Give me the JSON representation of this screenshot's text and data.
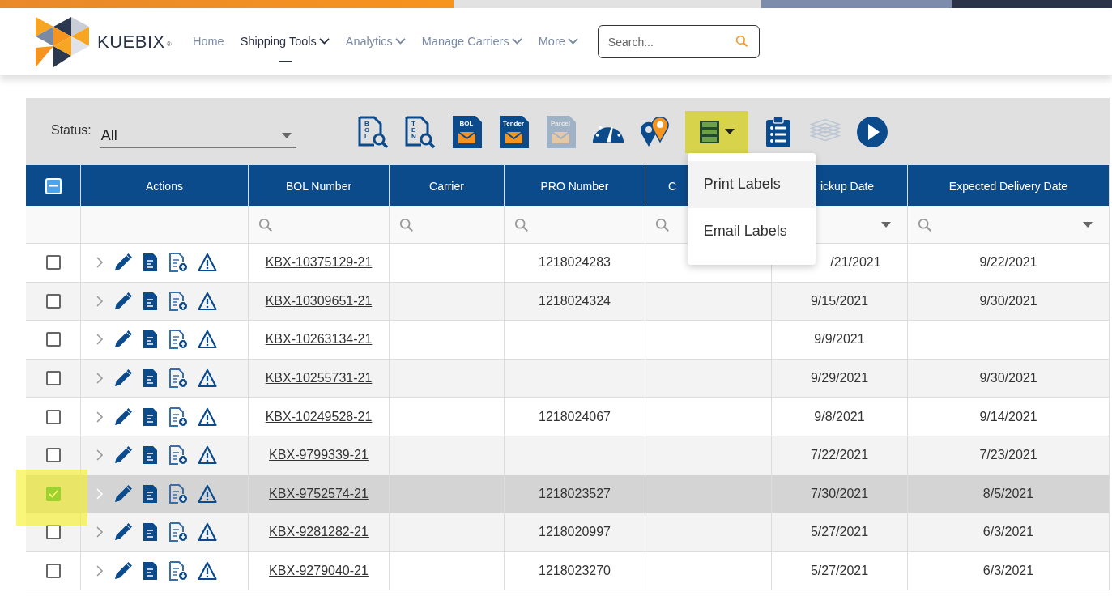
{
  "brand": {
    "name": "KUEBIX",
    "mark": "®"
  },
  "nav": {
    "items": [
      {
        "label": "Home",
        "selected": false,
        "dropdown": false
      },
      {
        "label": "Shipping Tools",
        "selected": true,
        "dropdown": true
      },
      {
        "label": "Analytics",
        "selected": false,
        "dropdown": true
      },
      {
        "label": "Manage Carriers",
        "selected": false,
        "dropdown": true
      },
      {
        "label": "More",
        "selected": false,
        "dropdown": true
      }
    ],
    "search": {
      "placeholder": "Search..."
    }
  },
  "status": {
    "label": "Status:",
    "value": "All"
  },
  "toolbar": [
    {
      "kind": "doc-search",
      "label": "BOL",
      "disabled": false
    },
    {
      "kind": "doc-search",
      "label": "TEN",
      "disabled": false
    },
    {
      "kind": "mail",
      "label": "BOL",
      "disabled": false
    },
    {
      "kind": "mail",
      "label": "Tender",
      "disabled": false
    },
    {
      "kind": "mail",
      "label": "Parcel",
      "disabled": true
    },
    {
      "kind": "gauge",
      "disabled": false
    },
    {
      "kind": "pins",
      "disabled": false
    },
    {
      "kind": "labels",
      "disabled": false,
      "highlighted": true
    },
    {
      "kind": "clipboard",
      "disabled": false
    },
    {
      "kind": "stack",
      "disabled": true
    },
    {
      "kind": "play",
      "disabled": false
    }
  ],
  "labels_menu": {
    "items": [
      {
        "label": "Print Labels",
        "highlighted": true
      },
      {
        "label": "Email Labels",
        "highlighted": false
      }
    ]
  },
  "table": {
    "some_selected": true,
    "columns": [
      {
        "label": "Actions",
        "search_filter": false,
        "dropdown_filter": false
      },
      {
        "label": "BOL Number",
        "search_filter": true,
        "dropdown_filter": false
      },
      {
        "label": "Carrier",
        "search_filter": true,
        "dropdown_filter": false
      },
      {
        "label": "PRO Number",
        "search_filter": true,
        "dropdown_filter": false
      },
      {
        "label": "C",
        "search_filter": true,
        "dropdown_filter": false
      },
      {
        "label": "ickup Date",
        "search_filter": false,
        "dropdown_filter": true
      },
      {
        "label": "Expected Delivery Date",
        "search_filter": true,
        "dropdown_filter": true
      }
    ],
    "rows": [
      {
        "checked": false,
        "highlighted": false,
        "bol": "KBX-10375129-21",
        "pro": "1218024283",
        "pickup": "/21/2021",
        "expected": "9/22/2021"
      },
      {
        "checked": false,
        "highlighted": false,
        "bol": "KBX-10309651-21",
        "pro": "1218024324",
        "pickup": "9/15/2021",
        "expected": "9/30/2021"
      },
      {
        "checked": false,
        "highlighted": false,
        "bol": "KBX-10263134-21",
        "pickup": "9/9/2021"
      },
      {
        "checked": false,
        "highlighted": false,
        "bol": "KBX-10255731-21",
        "pickup": "9/29/2021",
        "expected": "9/30/2021"
      },
      {
        "checked": false,
        "highlighted": false,
        "bol": "KBX-10249528-21",
        "pro": "1218024067",
        "pickup": "9/8/2021",
        "expected": "9/14/2021"
      },
      {
        "checked": false,
        "highlighted": false,
        "bol": "KBX-9799339-21",
        "pickup": "7/22/2021",
        "expected": "7/23/2021"
      },
      {
        "checked": true,
        "highlighted": true,
        "bol": "KBX-9752574-21",
        "pro": "1218023527",
        "pickup": "7/30/2021",
        "expected": "8/5/2021"
      },
      {
        "checked": false,
        "highlighted": false,
        "bol": "KBX-9281282-21",
        "pro": "1218020997",
        "pickup": "5/27/2021",
        "expected": "6/3/2021"
      },
      {
        "checked": false,
        "highlighted": false,
        "bol": "KBX-9279040-21",
        "pro": "1218023270",
        "pickup": "5/27/2021",
        "expected": "6/3/2021"
      }
    ]
  }
}
